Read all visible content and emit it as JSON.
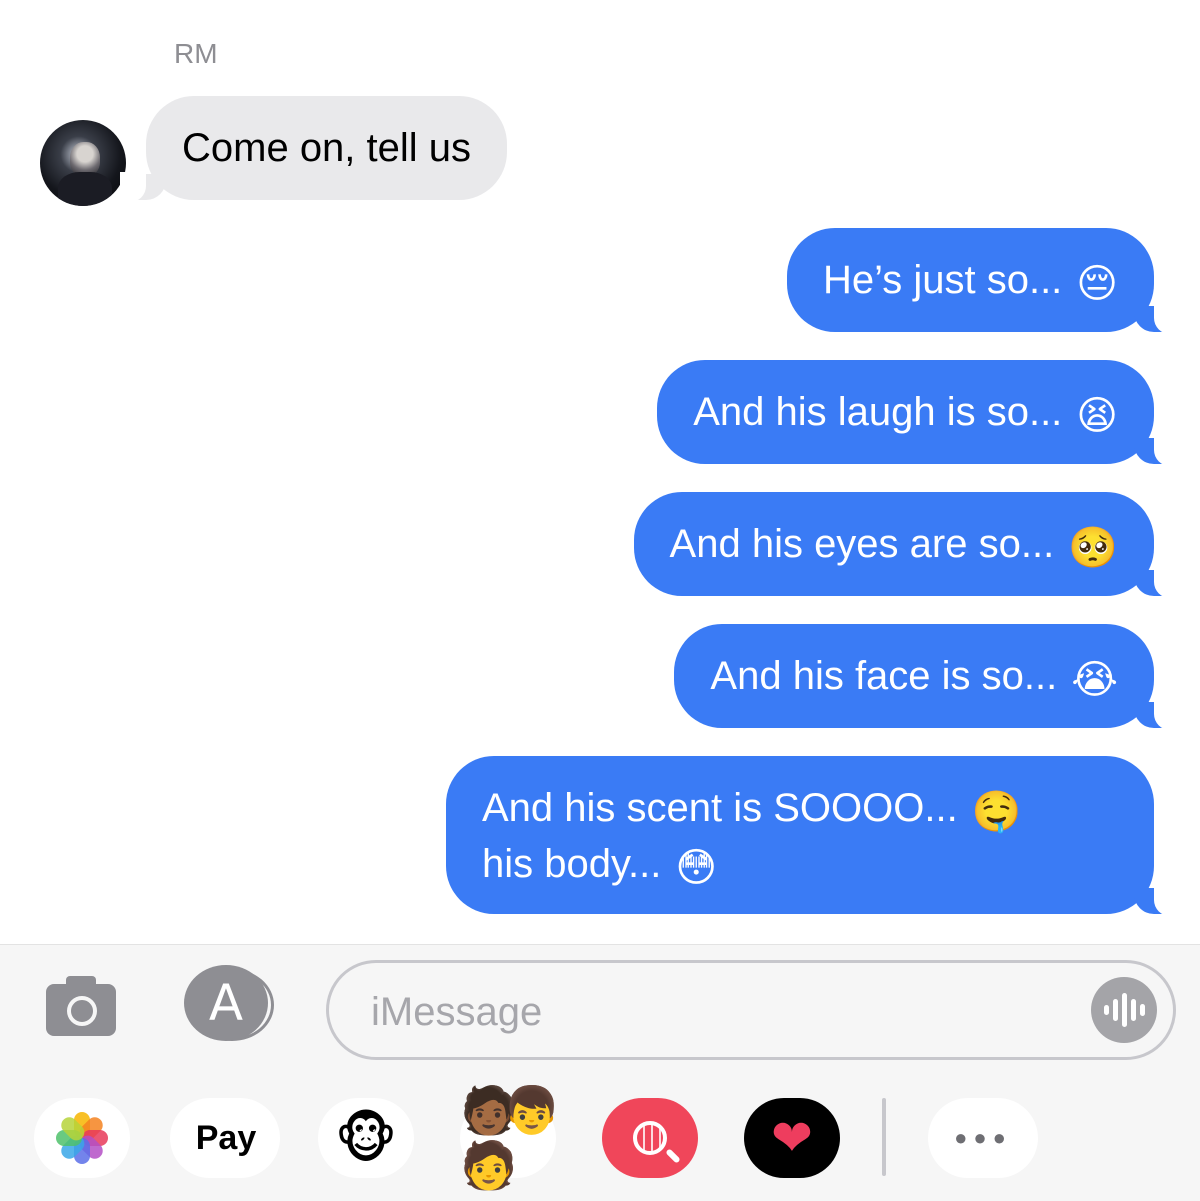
{
  "conversation": {
    "sender_name": "RM",
    "incoming": [
      {
        "text": "Come on, tell us"
      }
    ],
    "outgoing": [
      {
        "text": "He’s just so...",
        "emoji": "😔"
      },
      {
        "text": "And his laugh is so...",
        "emoji": "😫"
      },
      {
        "text": "And his eyes are so...",
        "emoji": "🥺"
      },
      {
        "text": "And his face is so...",
        "emoji": "😭"
      },
      {
        "line1": "And his scent is SOOOO...",
        "emoji1": "🤤",
        "line2": "his body...",
        "emoji2": "😳"
      }
    ]
  },
  "composer": {
    "placeholder": "iMessage",
    "camera_icon": "camera-icon",
    "appstore_icon": "app-store-icon",
    "audio_icon": "audio-waveform-icon"
  },
  "app_drawer": {
    "apps": [
      {
        "name": "photos-icon"
      },
      {
        "name": "apple-pay-icon",
        "label": "Pay",
        "glyph": ""
      },
      {
        "name": "animoji-icon",
        "glyph": "🐵"
      },
      {
        "name": "memoji-icon",
        "glyph": "🧑🏾👦🧑"
      },
      {
        "name": "image-search-icon"
      },
      {
        "name": "digital-touch-icon",
        "glyph": "❤"
      },
      {
        "name": "more-apps-icon",
        "glyph": "●●●"
      }
    ]
  },
  "colors": {
    "outgoing_bubble": "#3a7bf5",
    "incoming_bubble": "#e9e9eb",
    "search_app": "#f0465a"
  }
}
